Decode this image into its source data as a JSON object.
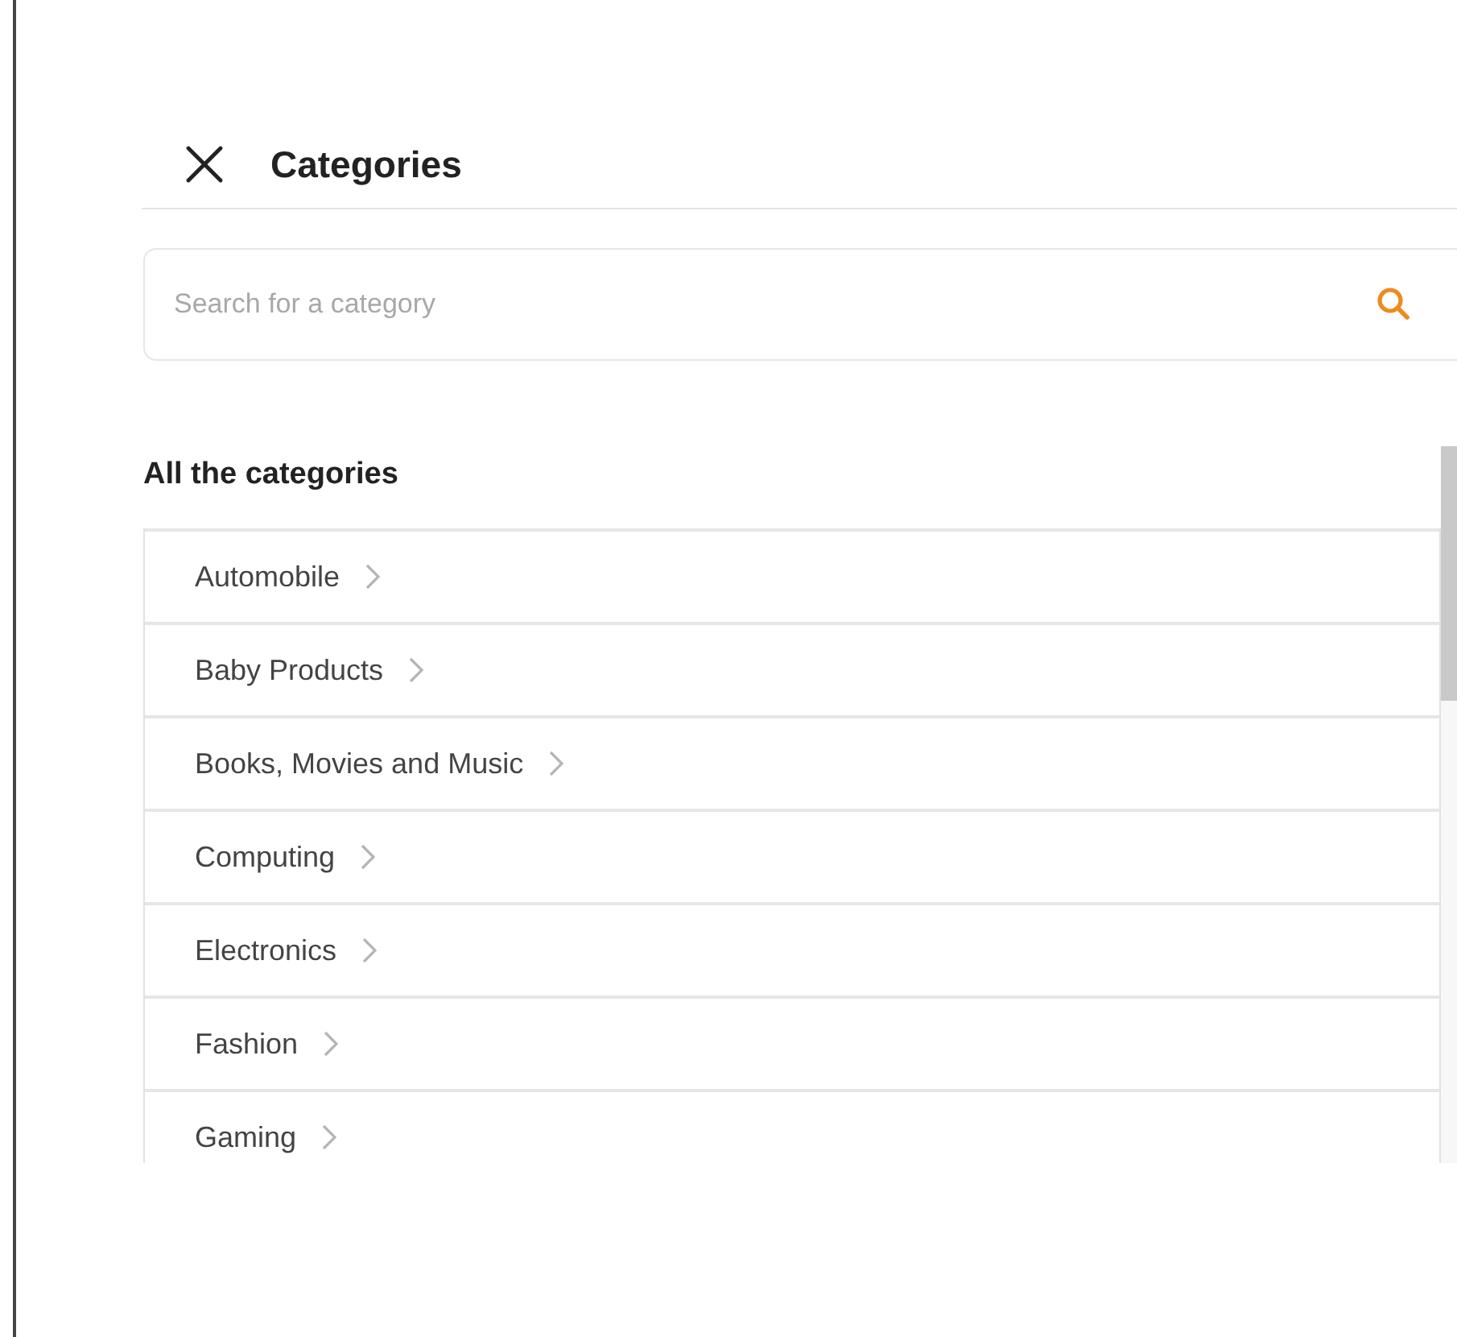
{
  "header": {
    "title": "Categories"
  },
  "search": {
    "placeholder": "Search for a category"
  },
  "section": {
    "heading": "All the categories"
  },
  "categories": [
    {
      "label": "Automobile"
    },
    {
      "label": "Baby Products"
    },
    {
      "label": "Books, Movies and Music"
    },
    {
      "label": "Computing"
    },
    {
      "label": "Electronics"
    },
    {
      "label": "Fashion"
    },
    {
      "label": "Gaming"
    }
  ]
}
